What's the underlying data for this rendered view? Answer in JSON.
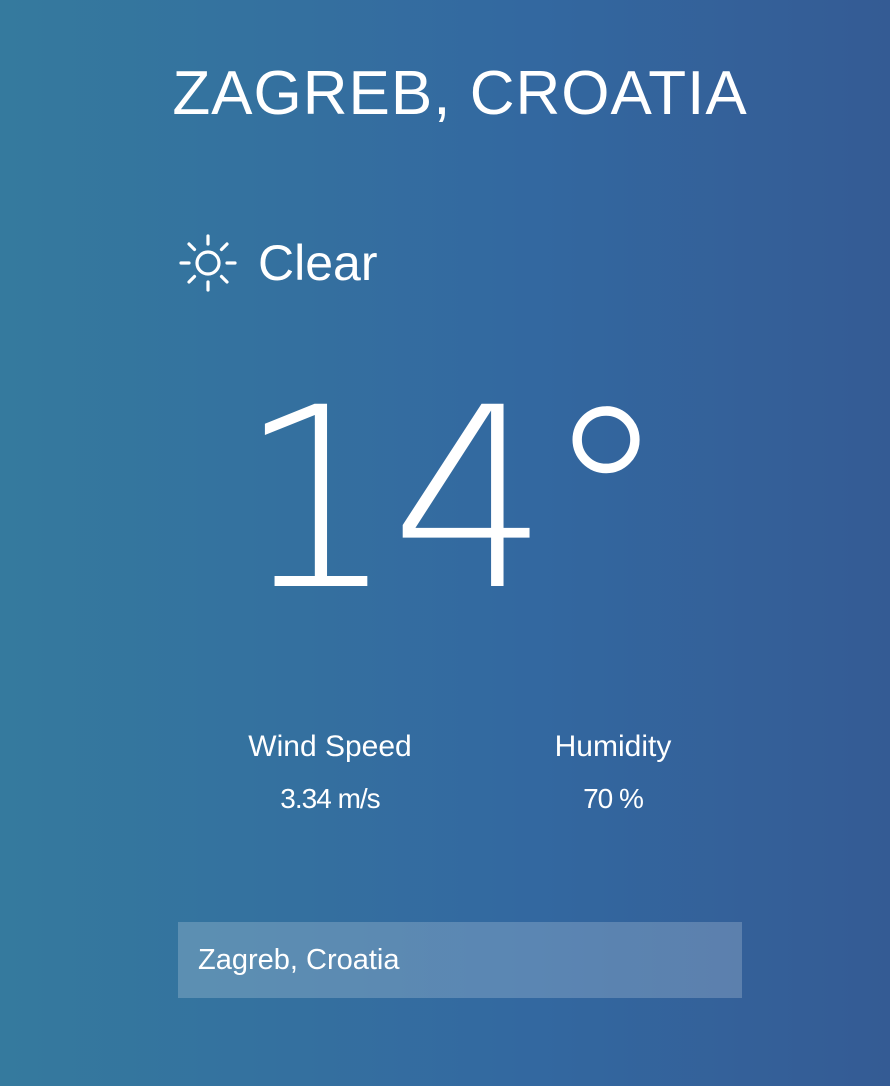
{
  "location": {
    "title": "ZAGREB, CROATIA"
  },
  "condition": {
    "icon": "sun-icon",
    "text": "Clear"
  },
  "temperature": {
    "value": "14°"
  },
  "stats": {
    "wind": {
      "label": "Wind Speed",
      "value": "3.34 m/s"
    },
    "humidity": {
      "label": "Humidity",
      "value": "70 %"
    }
  },
  "search": {
    "value": "Zagreb, Croatia"
  },
  "colors": {
    "background_left": "#357a9e",
    "background_right": "#345b94",
    "text": "#ffffff"
  }
}
